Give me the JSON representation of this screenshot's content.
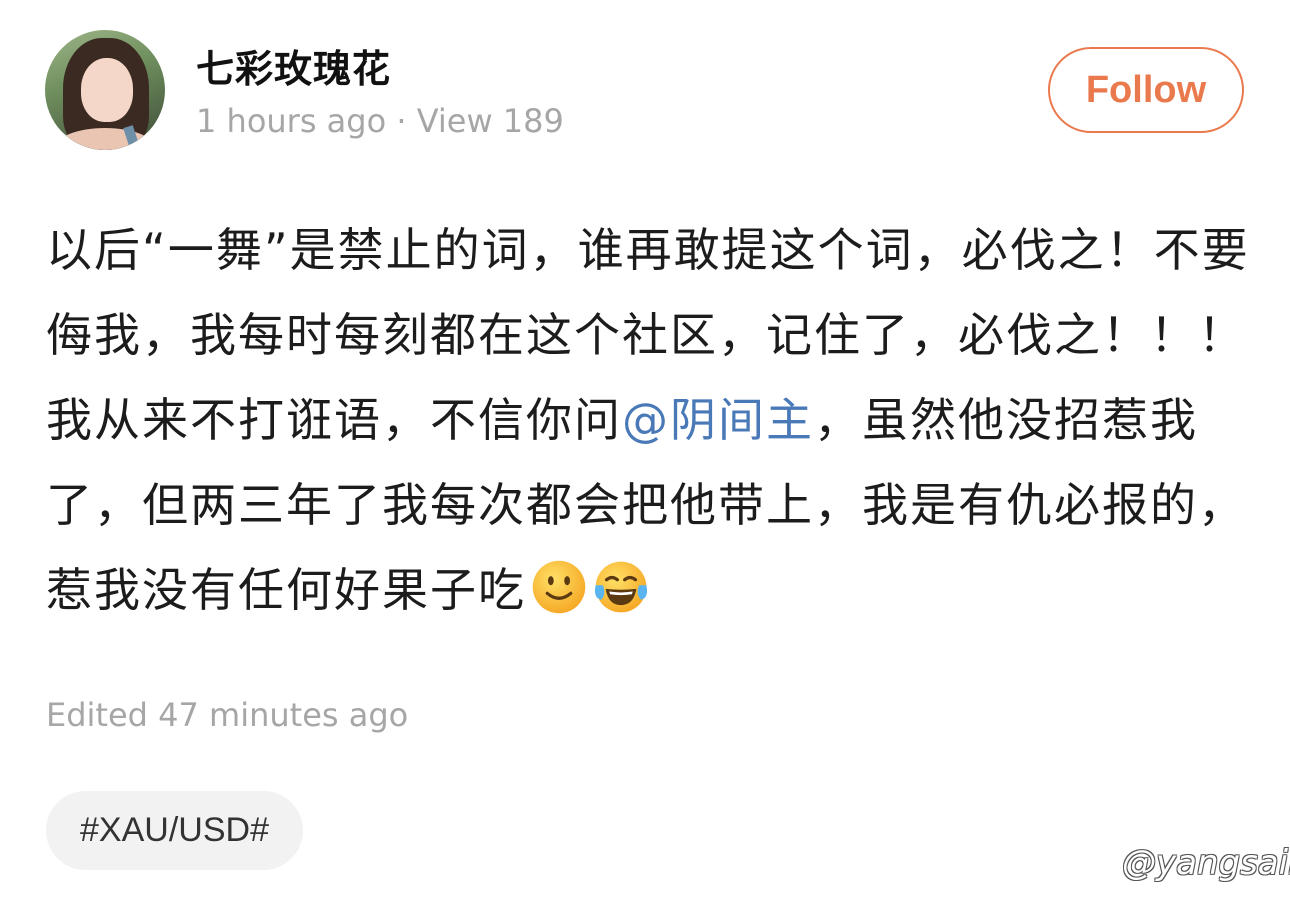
{
  "author": {
    "name": "七彩玫瑰花",
    "time": "1 hours ago",
    "separator": "·",
    "views": "View 189"
  },
  "follow_button": {
    "label": "Follow",
    "color": "#ea7a4e"
  },
  "post": {
    "text_before_mention": "以后“一舞”是禁止的词，谁再敢提这个词，必伐之！不要侮我，我每时每刻都在这个社区，记住了，必伐之！！！我从来不打诳语，不信你问",
    "mention": "@阴间主",
    "text_after_mention": "，虽然他没招惹我了，但两三年了我每次都会把他带上，我是有仇必报的，惹我没有任何好果子吃",
    "emojis": [
      "slightly-smiling-face-icon",
      "tears-of-joy-face-icon"
    ],
    "mention_color": "#4a79b8"
  },
  "edited": "Edited 47 minutes ago",
  "tag": "#XAU/USD#",
  "watermark": "@yangsail"
}
